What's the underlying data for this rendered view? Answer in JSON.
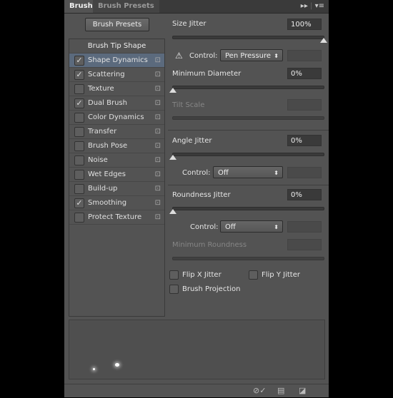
{
  "tabs": [
    {
      "label": "Brush"
    },
    {
      "label": "Brush Presets"
    }
  ],
  "brush_presets_button": "Brush Presets",
  "list": {
    "header": "Brush Tip Shape",
    "items": [
      {
        "label": "Shape Dynamics",
        "checked": true,
        "selected": true
      },
      {
        "label": "Scattering",
        "checked": true
      },
      {
        "label": "Texture",
        "checked": false
      },
      {
        "label": "Dual Brush",
        "checked": true
      },
      {
        "label": "Color Dynamics",
        "checked": false
      },
      {
        "label": "Transfer",
        "checked": false
      },
      {
        "label": "Brush Pose",
        "checked": false
      },
      {
        "label": "Noise",
        "checked": false
      },
      {
        "label": "Wet Edges",
        "checked": false
      },
      {
        "label": "Build-up",
        "checked": false
      },
      {
        "label": "Smoothing",
        "checked": true
      },
      {
        "label": "Protect Texture",
        "checked": false
      }
    ]
  },
  "size_jitter": {
    "label": "Size Jitter",
    "value": "100%",
    "level": 100
  },
  "control1": {
    "label": "Control:",
    "value": "Pen Pressure"
  },
  "min_diameter": {
    "label": "Minimum Diameter",
    "value": "0%",
    "level": 0
  },
  "tilt_scale": {
    "label": "Tilt Scale"
  },
  "angle_jitter": {
    "label": "Angle Jitter",
    "value": "0%",
    "level": 0
  },
  "control2": {
    "label": "Control:",
    "value": "Off"
  },
  "roundness_jitter": {
    "label": "Roundness Jitter",
    "value": "0%",
    "level": 0
  },
  "control3": {
    "label": "Control:",
    "value": "Off"
  },
  "min_roundness": {
    "label": "Minimum Roundness"
  },
  "flip_x": {
    "label": "Flip X Jitter",
    "checked": false
  },
  "flip_y": {
    "label": "Flip Y Jitter",
    "checked": false
  },
  "brush_projection": {
    "label": "Brush Projection",
    "checked": false
  }
}
